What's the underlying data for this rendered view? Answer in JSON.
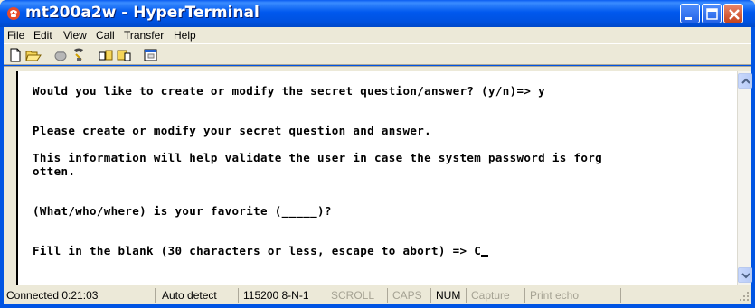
{
  "window": {
    "title": "mt200a2w - HyperTerminal",
    "icon": "hyperterminal-phone-icon"
  },
  "title_buttons": [
    "minimize-icon",
    "maximize-icon",
    "close-icon"
  ],
  "menu": [
    "File",
    "Edit",
    "View",
    "Call",
    "Transfer",
    "Help"
  ],
  "toolbar": [
    "new-icon",
    "open-icon",
    "connect-icon",
    "disconnect-icon",
    "send-icon",
    "receive-icon",
    "properties-icon"
  ],
  "terminal": {
    "lines": [
      "Would you like to create or modify the secret question/answer? (y/n)=> y",
      "Please create or modify your secret question and answer.",
      "This information will help validate the user in case the system password is forg",
      "otten.",
      "(What/who/where) is your favorite (_____)?",
      "Fill in the blank (30 characters or less, escape to abort) => C"
    ]
  },
  "status": {
    "connected": "Connected 0:21:03",
    "detect": "Auto detect",
    "settings": "115200 8-N-1",
    "scroll": "SCROLL",
    "caps": "CAPS",
    "num": "NUM",
    "capture": "Capture",
    "print_echo": "Print echo"
  }
}
